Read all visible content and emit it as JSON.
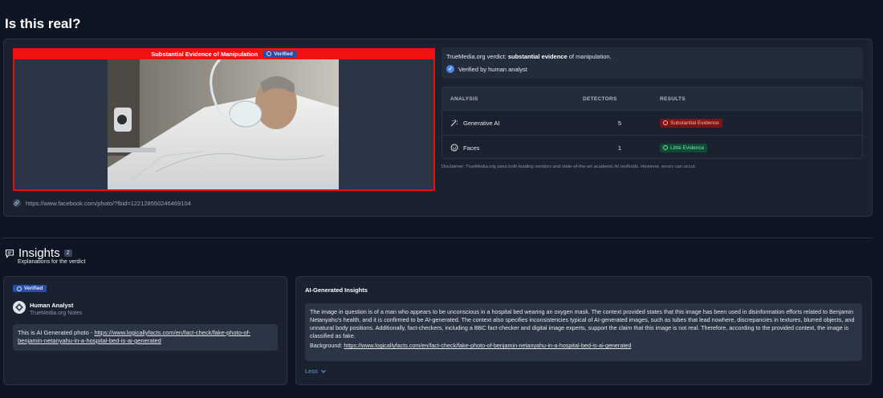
{
  "page": {
    "title": "Is this real?"
  },
  "media": {
    "banner_text": "Substantial Evidence of Manipulation",
    "verified_badge": "Verified",
    "source_url": "https://www.facebook.com/photo/?fbid=122128550246469104",
    "frame_color": "#e3120b"
  },
  "verdict": {
    "prefix": "TrueMedia.org verdict: ",
    "strong": "substantial evidence",
    "suffix": " of manipulation.",
    "verified_by": "Verified by human analyst"
  },
  "analysis_table": {
    "headers": [
      "ANALYSIS",
      "DETECTORS",
      "RESULTS"
    ],
    "rows": [
      {
        "icon": "generative-ai-icon",
        "label": "Generative AI",
        "detectors": "5",
        "result": "Substantial Evidence",
        "result_color": "#7a1418"
      },
      {
        "icon": "face-icon",
        "label": "Faces",
        "detectors": "1",
        "result": "Little Evidence",
        "result_color": "#0f4a32"
      }
    ],
    "disclaimer": "Disclaimer: TrueMedia.org uses both leading vendors and state-of-the-art academic AI methods. However, errors can occur."
  },
  "insights": {
    "title": "Insights",
    "count": "2",
    "subtitle": "Explanations for the verdict",
    "analyst": {
      "badge": "Verified",
      "name": "Human Analyst",
      "source": "TrueMedia.org Notes",
      "note_prefix": "This is AI Generated photo - ",
      "note_link": "https://www.logicallyfacts.com/en/fact-check/fake-photo-of-benjamin-netanyahu-in-a-hospital-bed-is-ai-generated"
    },
    "ai": {
      "title": "AI-Generated Insights",
      "body": "The image in question is of a man who appears to be unconscious in a hospital bed wearing an oxygen mask. The context provided states that this image has been used in disinformation efforts related to Benjamin Netanyahu's health, and it is confirmed to be AI-generated. The context also specifies inconsistencies typical of AI-generated images, such as tubes that lead nowhere, discrepancies in textures, blurred objects, and unnatural body positions. Additionally, fact-checkers, including a BBC fact-checker and digital image experts, support the claim that this image is not real. Therefore, according to the provided context, the image is classified as fake.",
      "background_label": "Background: ",
      "background_link": "https://www.logicallyfacts.com/en/fact-check/fake-photo-of-benjamin-netanyahu-in-a-hospital-bed-is-ai-generated",
      "toggle": "Less"
    }
  }
}
